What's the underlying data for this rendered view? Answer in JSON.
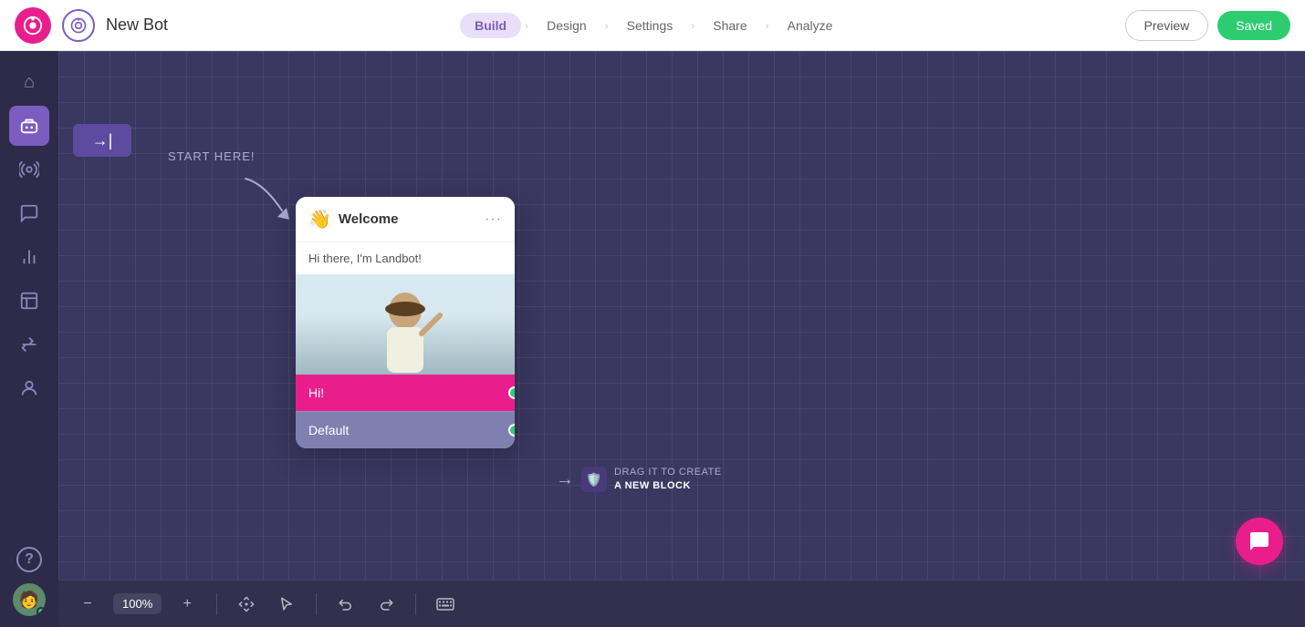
{
  "header": {
    "app_logo_alt": "Landbot logo",
    "bot_name": "New Bot",
    "nav": {
      "tabs": [
        {
          "id": "build",
          "label": "Build",
          "active": true
        },
        {
          "id": "design",
          "label": "Design",
          "active": false
        },
        {
          "id": "settings",
          "label": "Settings",
          "active": false
        },
        {
          "id": "share",
          "label": "Share",
          "active": false
        },
        {
          "id": "analyze",
          "label": "Analyze",
          "active": false
        }
      ]
    },
    "preview_btn": "Preview",
    "saved_btn": "Saved"
  },
  "sidebar": {
    "items": [
      {
        "id": "home",
        "icon": "⌂",
        "label": "Home"
      },
      {
        "id": "bot",
        "icon": "🤖",
        "label": "Bot"
      },
      {
        "id": "broadcast",
        "icon": "📡",
        "label": "Broadcast"
      },
      {
        "id": "messages",
        "icon": "💬",
        "label": "Messages"
      },
      {
        "id": "analytics",
        "icon": "📊",
        "label": "Analytics"
      },
      {
        "id": "templates",
        "icon": "🎁",
        "label": "Templates"
      },
      {
        "id": "integrations",
        "icon": "🤝",
        "label": "Integrations"
      },
      {
        "id": "leads",
        "icon": "😊",
        "label": "Leads"
      },
      {
        "id": "help",
        "icon": "?",
        "label": "Help"
      }
    ]
  },
  "canvas": {
    "start_here_label": "START HERE!",
    "welcome_card": {
      "emoji": "👋",
      "title": "Welcome",
      "message": "Hi there, I'm Landbot!",
      "buttons": [
        {
          "label": "Hi!",
          "type": "primary"
        },
        {
          "label": "Default",
          "type": "default"
        }
      ]
    },
    "drag_hint": {
      "prefix": "DRAG IT TO CREATE",
      "highlight": "A NEW BLOCK"
    }
  },
  "toolbar": {
    "zoom_level": "100%",
    "zoom_out_label": "−",
    "zoom_in_label": "+",
    "move_icon": "⊕",
    "select_icon": "↖",
    "undo_icon": "↩",
    "redo_icon": "↪",
    "keyboard_icon": "⌨"
  }
}
